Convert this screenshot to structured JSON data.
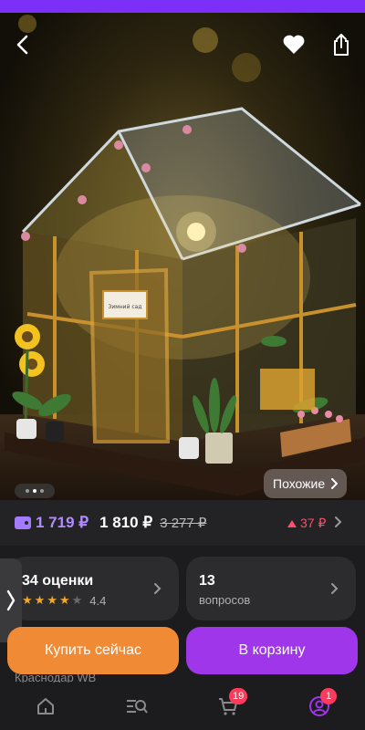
{
  "product_gallery": {
    "similar_label": "Похожие",
    "sign_text": "Зимний сад",
    "page_count": 3,
    "current_page": 2
  },
  "price_bar": {
    "wallet_price": "1 719 ₽",
    "price": "1 810 ₽",
    "old_price": "3 277 ₽",
    "change": "37 ₽"
  },
  "reviews_card": {
    "title": "34 оценки",
    "rating": "4.4",
    "stars_filled": 4
  },
  "questions_card": {
    "count": "13",
    "label": "вопросов"
  },
  "actions": {
    "buy_now": "Купить сейчас",
    "add_to_cart": "В корзину"
  },
  "location": "Краснодар WB",
  "bottom_nav": {
    "basket_badge": "19",
    "profile_badge": "1"
  },
  "icons": [
    "back-icon",
    "heart-icon",
    "share-icon",
    "chevron-right-icon",
    "wallet-icon",
    "home-icon",
    "catalog-search-icon",
    "cart-icon",
    "profile-icon"
  ],
  "colors": {
    "accent_purple": "#a036ea",
    "buy_orange": "#f08a35",
    "wallet_price": "#b18cff",
    "price_down": "#ff4d6a",
    "badge": "#ff3b5c"
  }
}
